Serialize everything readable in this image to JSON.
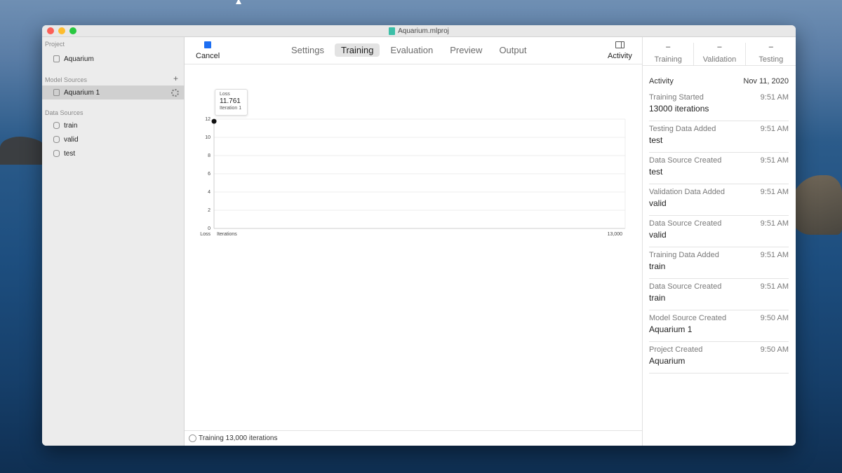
{
  "window": {
    "title": "Aquarium.mlproj"
  },
  "sidebar": {
    "project_header": "Project",
    "project_name": "Aquarium",
    "model_sources_header": "Model Sources",
    "model_sources": [
      {
        "label": "Aquarium 1"
      }
    ],
    "data_sources_header": "Data Sources",
    "data_sources": [
      {
        "label": "train"
      },
      {
        "label": "valid"
      },
      {
        "label": "test"
      }
    ]
  },
  "toolbar": {
    "cancel_label": "Cancel",
    "tabs": [
      {
        "label": "Settings"
      },
      {
        "label": "Training"
      },
      {
        "label": "Evaluation"
      },
      {
        "label": "Preview"
      },
      {
        "label": "Output"
      }
    ],
    "activity_label": "Activity",
    "active_tab": "Training"
  },
  "chart_data": {
    "type": "line",
    "ylabel": "Loss",
    "xlabel": "Iterations",
    "x_max_label": "13,000",
    "ylim": [
      0,
      12
    ],
    "yticks": [
      "0",
      "2",
      "4",
      "6",
      "8",
      "10",
      "12"
    ],
    "xlim": [
      0,
      13000
    ],
    "series": [
      {
        "name": "Loss",
        "x": [
          1
        ],
        "y": [
          11.761
        ]
      }
    ],
    "tooltip": {
      "title": "Loss",
      "value": "11.761",
      "sub": "Iteration 1"
    }
  },
  "status": {
    "text": "Training 13,000 iterations"
  },
  "metrics": [
    {
      "value": "–",
      "label": "Training"
    },
    {
      "value": "–",
      "label": "Validation"
    },
    {
      "value": "–",
      "label": "Testing"
    }
  ],
  "activity": {
    "header": "Activity",
    "date": "Nov 11, 2020",
    "items": [
      {
        "name": "Training Started",
        "time": "9:51 AM",
        "value": "13000 iterations"
      },
      {
        "name": "Testing Data Added",
        "time": "9:51 AM",
        "value": "test"
      },
      {
        "name": "Data Source Created",
        "time": "9:51 AM",
        "value": "test"
      },
      {
        "name": "Validation Data Added",
        "time": "9:51 AM",
        "value": "valid"
      },
      {
        "name": "Data Source Created",
        "time": "9:51 AM",
        "value": "valid"
      },
      {
        "name": "Training Data Added",
        "time": "9:51 AM",
        "value": "train"
      },
      {
        "name": "Data Source Created",
        "time": "9:51 AM",
        "value": "train"
      },
      {
        "name": "Model Source Created",
        "time": "9:50 AM",
        "value": "Aquarium 1"
      },
      {
        "name": "Project Created",
        "time": "9:50 AM",
        "value": "Aquarium"
      }
    ]
  },
  "colors": {
    "accent": "#1c6ef2",
    "selection": "#d0d0d0"
  }
}
